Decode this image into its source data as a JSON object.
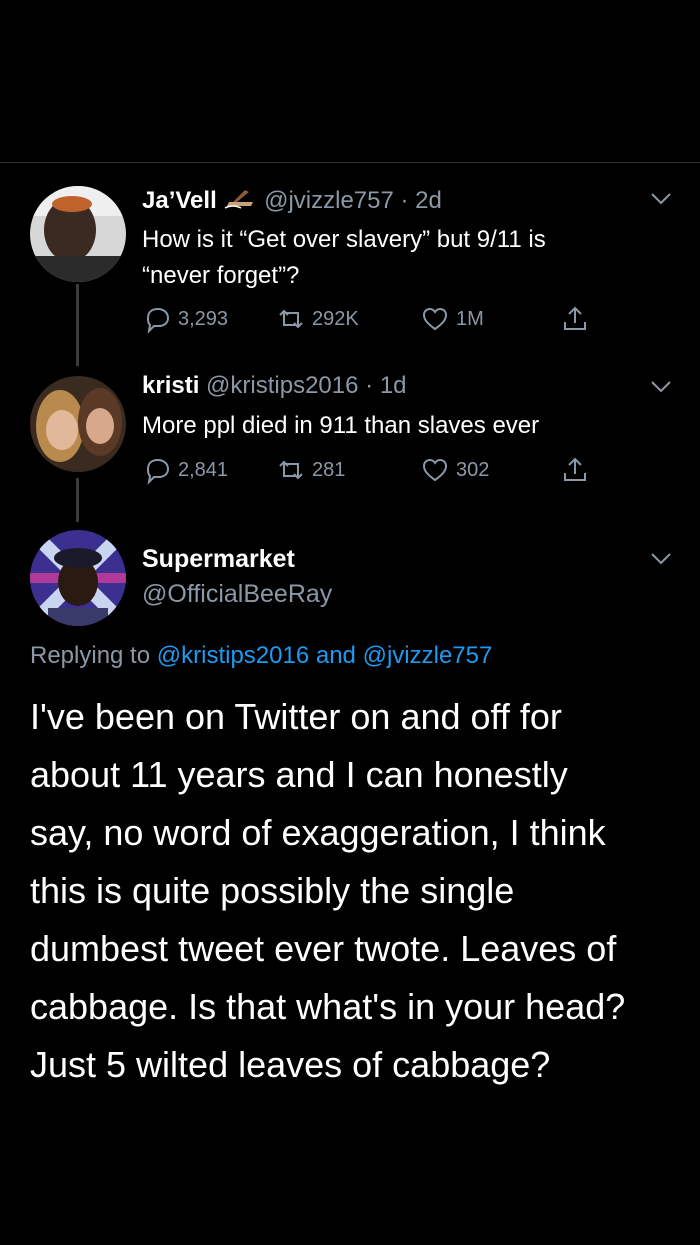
{
  "tweets": [
    {
      "name": "Ja’Vell",
      "handle": "@jvizzle757",
      "sep": "·",
      "time": "2d",
      "text_line1": "How is it “Get over slavery” but 9/11 is",
      "text_line2": "“never forget”?",
      "replies": "3,293",
      "retweets": "292K",
      "likes": "1M",
      "avatar_icon": "profile-photo"
    },
    {
      "name": "kristi",
      "handle": "@kristips2016",
      "sep": "·",
      "time": "1d",
      "text_line1": "More ppl died in 911 than slaves ever",
      "replies": "2,841",
      "retweets": "281",
      "likes": "302",
      "avatar_icon": "profile-photo"
    }
  ],
  "main_tweet": {
    "name": "Supermarket",
    "handle": "@OfficialBeeRay",
    "replying_prefix": "Replying to",
    "reply_handle_1": "@kristips2016",
    "reply_and": "and",
    "reply_handle_2": "@jvizzle757",
    "lines": [
      "I've been on Twitter on and off for",
      "about 11 years and I can honestly",
      "say, no word of exaggeration, I think",
      "this is quite possibly the single",
      "dumbest tweet ever twote. Leaves of",
      "cabbage. Is that what's in your head?",
      "Just 5 wilted leaves of cabbage?"
    ]
  },
  "colors": {
    "background": "#000000",
    "muted": "#8b98a5",
    "link": "#1d9bf0",
    "divider": "#2f3336"
  },
  "icons": [
    "reply-icon",
    "retweet-icon",
    "like-icon",
    "share-icon",
    "chevron-down-icon",
    "signature-emoji-icon"
  ]
}
